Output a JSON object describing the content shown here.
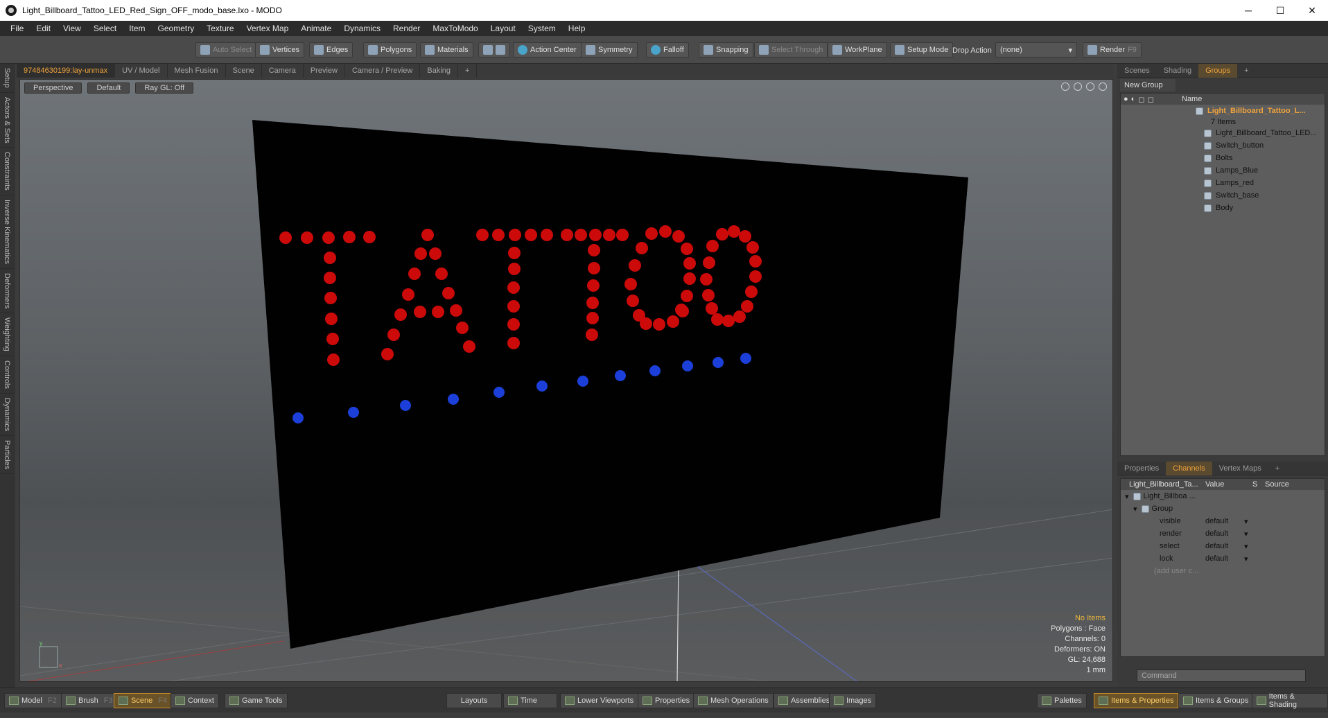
{
  "window": {
    "title": "Light_Billboard_Tattoo_LED_Red_Sign_OFF_modo_base.lxo - MODO",
    "minimize": "─",
    "maximize": "☐",
    "close": "✕"
  },
  "menu": [
    "File",
    "Edit",
    "View",
    "Select",
    "Item",
    "Geometry",
    "Texture",
    "Vertex Map",
    "Animate",
    "Dynamics",
    "Render",
    "MaxToModo",
    "Layout",
    "System",
    "Help"
  ],
  "toolbar": {
    "auto_select": "Auto Select",
    "vertices": "Vertices",
    "edges": "Edges",
    "polygons": "Polygons",
    "materials": "Materials",
    "action_center": "Action Center",
    "symmetry": "Symmetry",
    "falloff": "Falloff",
    "snapping": "Snapping",
    "select_through": "Select Through",
    "workplane": "WorkPlane",
    "setup_mode": "Setup Mode",
    "drop_action_label": "Drop Action",
    "drop_action_value": "(none)",
    "render": "Render",
    "render_key": "F9"
  },
  "left_tabs": [
    "Setup",
    "Actors & Sets",
    "Constraints",
    "Inverse Kinematics",
    "Deformers",
    "Weighting",
    "Controls",
    "Dynamics",
    "Particles"
  ],
  "viewport_tabs": [
    "97484630199:lay-unmax",
    "UV / Model",
    "Mesh Fusion",
    "Scene",
    "Camera",
    "Preview",
    "Camera / Preview",
    "Baking",
    "+"
  ],
  "viewport": {
    "view": "Perspective",
    "shading": "Default",
    "raygl": "Ray GL: Off",
    "sign_text": "TATTOO",
    "info": {
      "items": "No Items",
      "polygons": "Polygons : Face",
      "channels": "Channels: 0",
      "deformers": "Deformers: ON",
      "gl": "GL: 24,688",
      "units": "1 mm"
    },
    "colors": {
      "led_red": "#cc0a0a",
      "led_blue": "#1b3fd8",
      "board": "#000000"
    }
  },
  "scene_panel": {
    "tabs": [
      "Scenes",
      "Shading",
      "Groups",
      "+"
    ],
    "active_tab": "Groups",
    "new_group": "New Group",
    "name_header": "Name",
    "group_name": "Light_Billboard_Tattoo_L...",
    "group_count": "7 Items",
    "items": [
      "Light_Billboard_Tattoo_LED...",
      "Switch_button",
      "Bolts",
      "Lamps_Blue",
      "Lamps_red",
      "Switch_base",
      "Body"
    ]
  },
  "properties_panel": {
    "tabs": [
      "Properties",
      "Channels",
      "Vertex Maps",
      "+"
    ],
    "active_tab": "Channels",
    "headers": [
      "Light_Billboard_Ta...",
      "Value",
      "S",
      "Source"
    ],
    "root": "Light_Billboa ...",
    "group": "Group",
    "rows": [
      {
        "name": "visible",
        "value": "default"
      },
      {
        "name": "render",
        "value": "default"
      },
      {
        "name": "select",
        "value": "default"
      },
      {
        "name": "lock",
        "value": "default"
      }
    ],
    "add_user": "(add user c...",
    "command_placeholder": "Command"
  },
  "bottom_bar": {
    "model": "Model",
    "model_key": "F2",
    "brush": "Brush",
    "brush_key": "F3",
    "scene": "Scene",
    "scene_key": "F4",
    "context": "Context",
    "game_tools": "Game Tools",
    "layouts": "Layouts",
    "time": "Time",
    "lower_viewports": "Lower Viewports",
    "properties": "Properties",
    "mesh_operations": "Mesh Operations",
    "assemblies": "Assemblies",
    "images": "Images",
    "palettes": "Palettes",
    "items_properties": "Items & Properties",
    "items_groups": "Items & Groups",
    "items_shading": "Items & Shading"
  }
}
